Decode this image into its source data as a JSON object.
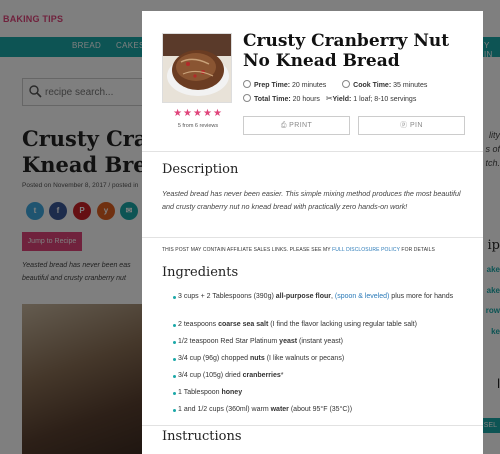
{
  "background": {
    "site_logo": "BAKING TIPS",
    "nav_items": [
      "BREAD",
      "CAKES",
      "Y IN"
    ],
    "search_placeholder": "recipe search...",
    "title": "Crusty Cran Knead Brea",
    "posted": "Posted on November 8, 2017 / posted in",
    "jump_button": "Jump to Recipe",
    "intro_line1": "Yeasted bread has never been eas",
    "intro_line2": "beautiful and crusty cranberry nut",
    "right_fragments": [
      "lity",
      "s of",
      "tch.",
      "ip",
      "ake",
      "ake",
      "row",
      "ke",
      "l",
      "SEL"
    ],
    "social_icons": [
      "twitter-icon",
      "facebook-icon",
      "pinterest-icon",
      "yummly-icon",
      "email-icon"
    ]
  },
  "recipe": {
    "title": "Crusty Cranberry Nut No Knead Bread",
    "rating_stars": "★★★★★",
    "rating_value": 5,
    "reviews": "5 from 6 reviews",
    "prep_label": "Prep Time:",
    "prep_value": "20 minutes",
    "cook_label": "Cook Time:",
    "cook_value": "35 minutes",
    "total_label": "Total Time:",
    "total_value": "20 hours",
    "yield_label": "Yield:",
    "yield_value": "1 loaf; 8-10 servings",
    "print_label": "PRINT",
    "pin_label": "PIN",
    "description_heading": "Description",
    "description": "Yeasted bread has never been easier. This simple mixing method produces the most beautiful and crusty cranberry nut no knead bread with practically zero hands-on work!",
    "affiliate_prefix": "THIS POST MAY CONTAIN AFFILIATE SALES LINKS. PLEASE SEE MY",
    "affiliate_link": "FULL DISCLOSURE POLICY",
    "affiliate_suffix": "FOR DETAILS",
    "ingredients_heading": "Ingredients",
    "ingredients": [
      {
        "pre": "3 cups + 2 Tablespoons (390g) ",
        "bold": "all-purpose flour",
        "post": ", ",
        "link": "(spoon & leveled)",
        "tail": " plus more for hands"
      },
      {
        "pre": "2 teaspoons ",
        "bold": "coarse sea salt",
        "post": " (I find the flavor lacking using regular table salt)",
        "link": "",
        "tail": ""
      },
      {
        "pre": "1/2 teaspoon Red Star Platinum ",
        "bold": "yeast",
        "post": " (instant yeast)",
        "link": "",
        "tail": ""
      },
      {
        "pre": "3/4 cup (96g) chopped ",
        "bold": "nuts",
        "post": " (I like walnuts or pecans)",
        "link": "",
        "tail": ""
      },
      {
        "pre": "3/4 cup (105g) dried ",
        "bold": "cranberries",
        "post": "*",
        "link": "",
        "tail": ""
      },
      {
        "pre": "1 Tablespoon ",
        "bold": "honey",
        "post": "",
        "link": "",
        "tail": ""
      },
      {
        "pre": "1 and 1/2 cups (360ml) warm ",
        "bold": "water",
        "post": " (about 95°F (35°C))",
        "link": "",
        "tail": ""
      }
    ],
    "instructions_heading": "Instructions"
  },
  "colors": {
    "accent_pink": "#e0457b",
    "accent_teal": "#1ba8a8",
    "link_blue": "#2a7ab8"
  }
}
